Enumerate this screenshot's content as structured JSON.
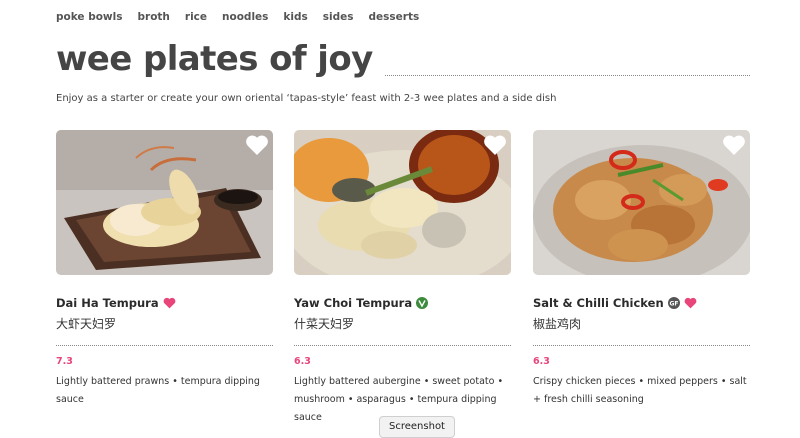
{
  "nav": [
    "poke bowls",
    "broth",
    "rice",
    "noodles",
    "kids",
    "sides",
    "desserts"
  ],
  "page_title": "wee plates of joy",
  "intro": "Enjoy as a starter or create your own oriental ‘tapas-style’ feast with 2-3 wee plates and a side dish",
  "cards": [
    {
      "name": "Dai Ha Tempura",
      "chinese": "大虾天妇罗",
      "price": "7.3",
      "description": "Lightly battered prawns • tempura dipping sauce",
      "badges": [
        "heart-icon"
      ]
    },
    {
      "name": "Yaw Choi Tempura",
      "chinese": "什菜天妇罗",
      "price": "6.3",
      "description": "Lightly battered aubergine • sweet potato • mushroom • asparagus • tempura dipping sauce",
      "badges": [
        "vegan-icon"
      ]
    },
    {
      "name": "Salt & Chilli Chicken",
      "chinese": "椒盐鸡肉",
      "price": "6.3",
      "description": "Crispy chicken pieces • mixed peppers • salt + fresh chilli seasoning",
      "badges": [
        "gluten-free-icon",
        "heart-icon"
      ],
      "gf_label": "GF"
    }
  ],
  "screenshot_label": "Screenshot",
  "colors": {
    "accent": "#e8457a",
    "vegan": "#3d8b3d"
  }
}
